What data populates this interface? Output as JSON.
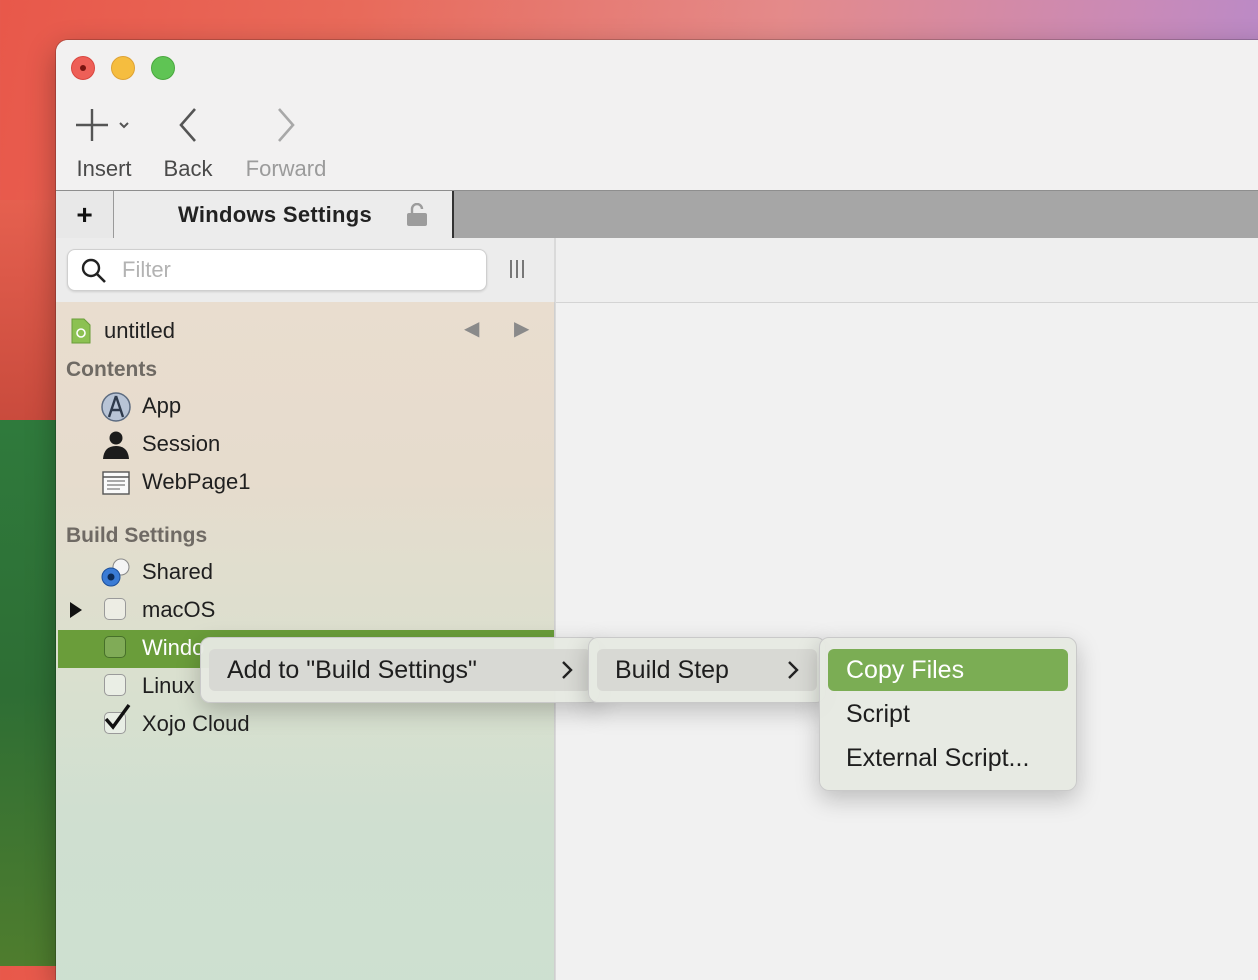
{
  "toolbar": {
    "insert_label": "Insert",
    "back_label": "Back",
    "forward_label": "Forward"
  },
  "tabs": {
    "add_label": "+",
    "active_title": "Windows Settings"
  },
  "navigator": {
    "filter_placeholder": "Filter",
    "project_name": "untitled",
    "contents_header": "Contents",
    "contents": [
      {
        "label": "App",
        "icon": "app-icon"
      },
      {
        "label": "Session",
        "icon": "session-icon"
      },
      {
        "label": "WebPage1",
        "icon": "webpage-icon"
      }
    ],
    "build_header": "Build Settings",
    "build_items": [
      {
        "label": "Shared",
        "icon": "shared-icon"
      },
      {
        "label": "macOS",
        "checked": false
      },
      {
        "label": "Windows",
        "checked": false,
        "visible_text": "Windo"
      },
      {
        "label": "Linux",
        "checked": false
      },
      {
        "label": "Xojo Cloud",
        "checked": true
      }
    ]
  },
  "context_menu": {
    "level1": [
      {
        "label": "Add to \"Build Settings\"",
        "has_submenu": true
      }
    ],
    "level2": [
      {
        "label": "Build Step",
        "has_submenu": true
      }
    ],
    "level3": [
      {
        "label": "Copy Files",
        "highlighted": true
      },
      {
        "label": "Script"
      },
      {
        "label": "External Script..."
      }
    ]
  },
  "colors": {
    "selection_green": "#6a9d3a",
    "menu_highlight": "#7bad54",
    "close": "#ee5f57",
    "minimize": "#f5bd3f",
    "maximize": "#5fc454"
  }
}
